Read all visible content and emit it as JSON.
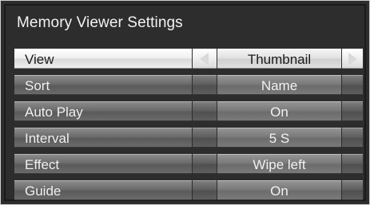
{
  "window": {
    "title": "Memory Viewer Settings"
  },
  "settings": [
    {
      "label": "View",
      "value": "Thumbnail",
      "selected": true
    },
    {
      "label": "Sort",
      "value": "Name",
      "selected": false
    },
    {
      "label": "Auto Play",
      "value": "On",
      "selected": false
    },
    {
      "label": "Interval",
      "value": "5 S",
      "selected": false
    },
    {
      "label": "Effect",
      "value": "Wipe left",
      "selected": false
    },
    {
      "label": "Guide",
      "value": "On",
      "selected": false
    }
  ],
  "icons": {
    "left": "arrow-left-icon",
    "right": "arrow-right-icon"
  }
}
